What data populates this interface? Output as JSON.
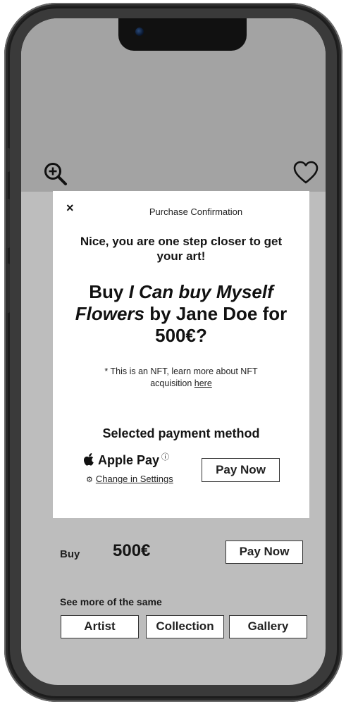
{
  "modal": {
    "close_label": "×",
    "title": "Purchase Confirmation",
    "subtitle": "Nice, you are one step closer to get your art!",
    "headline_prefix": "Buy ",
    "artwork_title": "I Can buy Myself Flowers",
    "headline_by": " by Jane Doe for ",
    "price": "500€?",
    "nft_note": "* This is an NFT, learn more about NFT acquisition ",
    "nft_link": "here",
    "payment_heading": "Selected payment method",
    "payment_method": "Apple Pay",
    "info_symbol": "ⓘ",
    "settings_link": "Change in Settings",
    "pay_button": "Pay Now"
  },
  "page": {
    "buy_label": "Buy",
    "price": "500€",
    "pay_button": "Pay Now",
    "more_label": "See more of the same",
    "filters": [
      "Artist",
      "Collection",
      "Gallery"
    ]
  },
  "icons": {
    "zoom": "zoom-in-icon",
    "favorite": "heart-icon",
    "close": "close-icon",
    "apple": "apple-logo-icon",
    "info": "info-icon",
    "settings": "gear-icon"
  },
  "colors": {
    "backdrop_top": "#a3a3a3",
    "backdrop": "#bdbdbd",
    "modal": "#ffffff",
    "frame": "#1c1c1c"
  }
}
